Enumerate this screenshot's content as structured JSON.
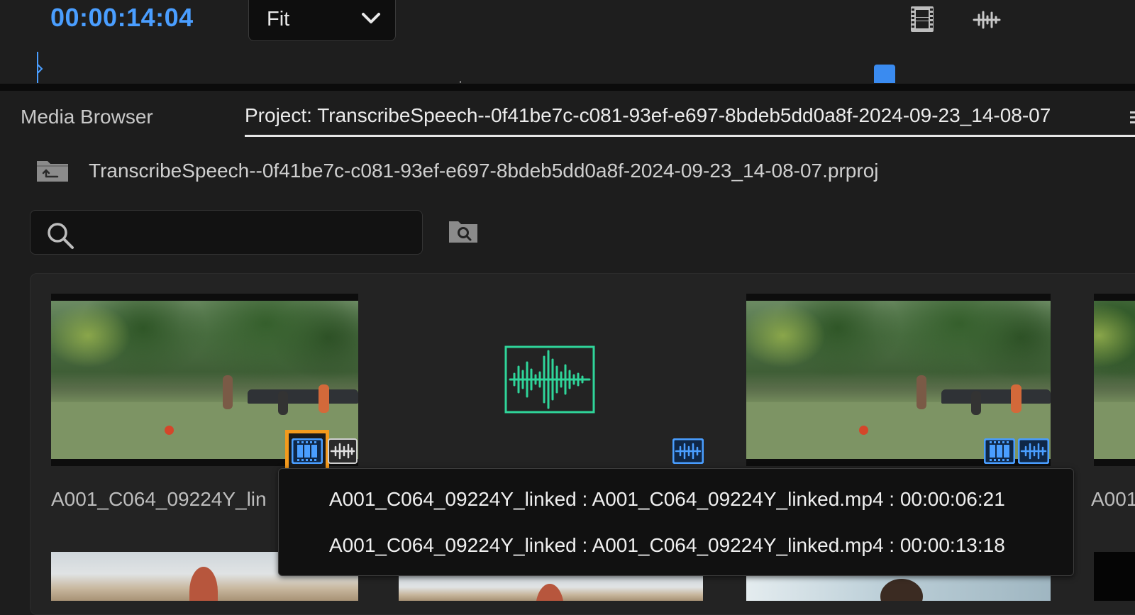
{
  "monitor": {
    "timecode": "00:00:14:04",
    "zoom_value": "Fit"
  },
  "tabs": [
    {
      "label": "Media Browser",
      "active": false
    },
    {
      "label": "Project: TranscribeSpeech--0f41be7c-c081-93ef-e697-8bdeb5dd0a8f-2024-09-23_14-08-07",
      "active": true
    }
  ],
  "breadcrumb": {
    "filename": "TranscribeSpeech--0f41be7c-c081-93ef-e697-8bdeb5dd0a8f-2024-09-23_14-08-07.prproj"
  },
  "search": {
    "value": "",
    "placeholder": ""
  },
  "clips": [
    {
      "label": "A001_C064_09224Y_lin",
      "thumbnail": "soccer-field",
      "badges": [
        "video-icon",
        "audio-icon"
      ],
      "highlighted_badge": "video-icon"
    },
    {
      "label": "",
      "thumbnail": "audio-waveform",
      "badges": [
        "audio-icon"
      ]
    },
    {
      "label": "",
      "thumbnail": "soccer-field",
      "badges": [
        "video-icon",
        "audio-icon"
      ]
    },
    {
      "label": "A001",
      "thumbnail": "soccer-field",
      "badges": []
    }
  ],
  "tooltip": {
    "lines": [
      "A001_C064_09224Y_linked : A001_C064_09224Y_linked.mp4 : 00:00:06:21",
      "A001_C064_09224Y_linked : A001_C064_09224Y_linked.mp4 : 00:00:13:18"
    ]
  },
  "colors": {
    "accent_blue": "#4a9eff",
    "highlight_orange": "#f39a1d",
    "audio_green": "#2fd59a"
  }
}
